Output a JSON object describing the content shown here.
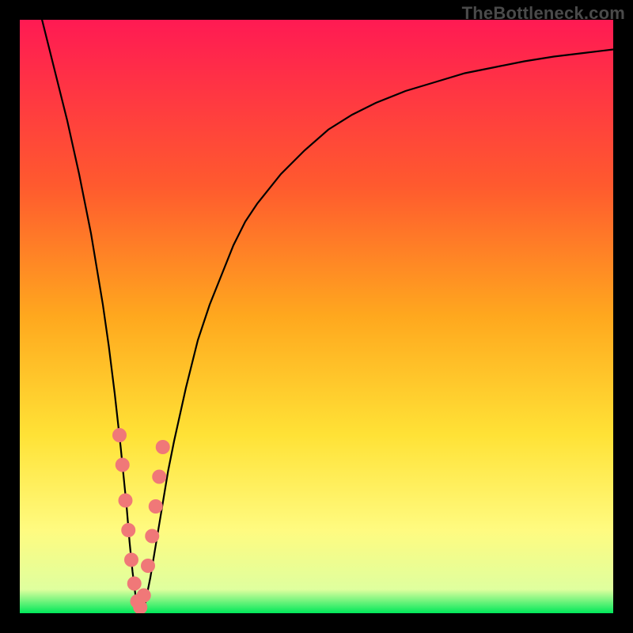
{
  "watermark": "TheBottleneck.com",
  "colors": {
    "frame": "#000000",
    "gradient_top": "#ff1a53",
    "gradient_mid1": "#ff5a2e",
    "gradient_mid2": "#ffa81e",
    "gradient_mid3": "#ffe236",
    "gradient_mid4": "#fffb80",
    "gradient_bottom": "#00e85a",
    "curve": "#000000",
    "markers": "#f07878"
  },
  "chart_data": {
    "type": "line",
    "title": "",
    "xlabel": "",
    "ylabel": "",
    "xlim": [
      0,
      100
    ],
    "ylim": [
      0,
      100
    ],
    "x": [
      0,
      2,
      4,
      6,
      8,
      10,
      12,
      13,
      14,
      15,
      16,
      17,
      18,
      18.5,
      19,
      19.5,
      20,
      20.5,
      21,
      22,
      23,
      24,
      25,
      26,
      28,
      30,
      32,
      34,
      36,
      38,
      40,
      44,
      48,
      52,
      56,
      60,
      65,
      70,
      75,
      80,
      85,
      90,
      95,
      100
    ],
    "y": [
      115,
      107,
      99,
      91,
      83,
      74,
      64,
      58,
      52,
      45,
      37,
      28,
      18,
      12,
      7,
      3,
      1,
      0.5,
      1,
      6,
      12,
      18,
      24,
      29,
      38,
      46,
      52,
      57,
      62,
      66,
      69,
      74,
      78,
      81.5,
      84,
      86,
      88,
      89.5,
      91,
      92,
      93,
      93.8,
      94.4,
      95
    ],
    "markers": {
      "x": [
        16.8,
        17.3,
        17.8,
        18.3,
        18.8,
        19.3,
        19.8,
        20.3,
        20.9,
        21.6,
        22.3,
        22.9,
        23.5,
        24.1
      ],
      "y": [
        30,
        25,
        19,
        14,
        9,
        5,
        2,
        1,
        3,
        8,
        13,
        18,
        23,
        28
      ]
    }
  }
}
